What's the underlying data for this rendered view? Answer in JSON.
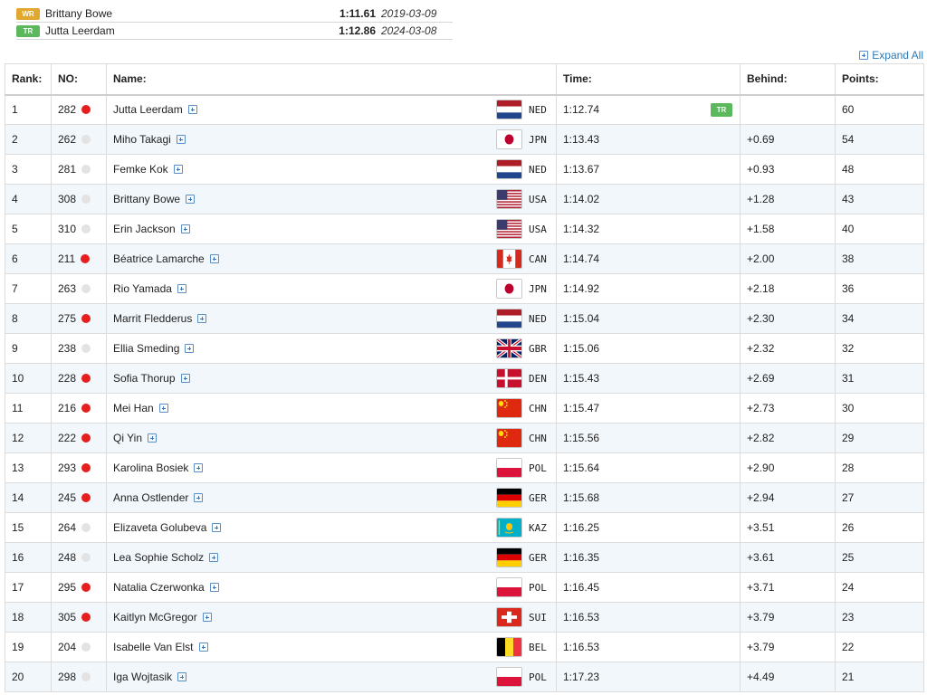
{
  "records": [
    {
      "badge": "WR",
      "badge_color": "#e0a82e",
      "name": "Brittany Bowe",
      "time": "1:11.61",
      "date": "2019-03-09"
    },
    {
      "badge": "TR",
      "badge_color": "#5cb85c",
      "name": "Jutta Leerdam",
      "time": "1:12.86",
      "date": "2024-03-08"
    }
  ],
  "expand_all_label": "Expand All",
  "table": {
    "headers": {
      "rank": "Rank:",
      "no": "NO:",
      "name": "Name:",
      "time": "Time:",
      "behind": "Behind:",
      "points": "Points:"
    },
    "tr_badge": "TR",
    "rows": [
      {
        "rank": "1",
        "no": "282",
        "dot": "red",
        "name": "Jutta Leerdam",
        "flag": "NED",
        "code": "NED",
        "time": "1:12.74",
        "badge": "TR",
        "behind": "",
        "points": "60"
      },
      {
        "rank": "2",
        "no": "262",
        "dot": "grey",
        "name": "Miho Takagi",
        "flag": "JPN",
        "code": "JPN",
        "time": "1:13.43",
        "badge": "",
        "behind": "+0.69",
        "points": "54"
      },
      {
        "rank": "3",
        "no": "281",
        "dot": "grey",
        "name": "Femke Kok",
        "flag": "NED",
        "code": "NED",
        "time": "1:13.67",
        "badge": "",
        "behind": "+0.93",
        "points": "48"
      },
      {
        "rank": "4",
        "no": "308",
        "dot": "grey",
        "name": "Brittany Bowe",
        "flag": "USA",
        "code": "USA",
        "time": "1:14.02",
        "badge": "",
        "behind": "+1.28",
        "points": "43"
      },
      {
        "rank": "5",
        "no": "310",
        "dot": "grey",
        "name": "Erin Jackson",
        "flag": "USA",
        "code": "USA",
        "time": "1:14.32",
        "badge": "",
        "behind": "+1.58",
        "points": "40"
      },
      {
        "rank": "6",
        "no": "211",
        "dot": "red",
        "name": "Béatrice Lamarche",
        "flag": "CAN",
        "code": "CAN",
        "time": "1:14.74",
        "badge": "",
        "behind": "+2.00",
        "points": "38"
      },
      {
        "rank": "7",
        "no": "263",
        "dot": "grey",
        "name": "Rio Yamada",
        "flag": "JPN",
        "code": "JPN",
        "time": "1:14.92",
        "badge": "",
        "behind": "+2.18",
        "points": "36"
      },
      {
        "rank": "8",
        "no": "275",
        "dot": "red",
        "name": "Marrit Fledderus",
        "flag": "NED",
        "code": "NED",
        "time": "1:15.04",
        "badge": "",
        "behind": "+2.30",
        "points": "34"
      },
      {
        "rank": "9",
        "no": "238",
        "dot": "grey",
        "name": "Ellia Smeding",
        "flag": "GBR",
        "code": "GBR",
        "time": "1:15.06",
        "badge": "",
        "behind": "+2.32",
        "points": "32"
      },
      {
        "rank": "10",
        "no": "228",
        "dot": "red",
        "name": "Sofia Thorup",
        "flag": "DEN",
        "code": "DEN",
        "time": "1:15.43",
        "badge": "",
        "behind": "+2.69",
        "points": "31"
      },
      {
        "rank": "11",
        "no": "216",
        "dot": "red",
        "name": "Mei Han",
        "flag": "CHN",
        "code": "CHN",
        "time": "1:15.47",
        "badge": "",
        "behind": "+2.73",
        "points": "30"
      },
      {
        "rank": "12",
        "no": "222",
        "dot": "red",
        "name": "Qi Yin",
        "flag": "CHN",
        "code": "CHN",
        "time": "1:15.56",
        "badge": "",
        "behind": "+2.82",
        "points": "29"
      },
      {
        "rank": "13",
        "no": "293",
        "dot": "red",
        "name": "Karolina Bosiek",
        "flag": "POL",
        "code": "POL",
        "time": "1:15.64",
        "badge": "",
        "behind": "+2.90",
        "points": "28"
      },
      {
        "rank": "14",
        "no": "245",
        "dot": "red",
        "name": "Anna Ostlender",
        "flag": "GER",
        "code": "GER",
        "time": "1:15.68",
        "badge": "",
        "behind": "+2.94",
        "points": "27"
      },
      {
        "rank": "15",
        "no": "264",
        "dot": "grey",
        "name": "Elizaveta Golubeva",
        "flag": "KAZ",
        "code": "KAZ",
        "time": "1:16.25",
        "badge": "",
        "behind": "+3.51",
        "points": "26"
      },
      {
        "rank": "16",
        "no": "248",
        "dot": "grey",
        "name": "Lea Sophie Scholz",
        "flag": "GER",
        "code": "GER",
        "time": "1:16.35",
        "badge": "",
        "behind": "+3.61",
        "points": "25"
      },
      {
        "rank": "17",
        "no": "295",
        "dot": "red",
        "name": "Natalia Czerwonka",
        "flag": "POL",
        "code": "POL",
        "time": "1:16.45",
        "badge": "",
        "behind": "+3.71",
        "points": "24"
      },
      {
        "rank": "18",
        "no": "305",
        "dot": "red",
        "name": "Kaitlyn McGregor",
        "flag": "SUI",
        "code": "SUI",
        "time": "1:16.53",
        "badge": "",
        "behind": "+3.79",
        "points": "23"
      },
      {
        "rank": "19",
        "no": "204",
        "dot": "grey",
        "name": "Isabelle Van Elst",
        "flag": "BEL",
        "code": "BEL",
        "time": "1:16.53",
        "badge": "",
        "behind": "+3.79",
        "points": "22"
      },
      {
        "rank": "20",
        "no": "298",
        "dot": "grey",
        "name": "Iga Wojtasik",
        "flag": "POL",
        "code": "POL",
        "time": "1:17.23",
        "badge": "",
        "behind": "+4.49",
        "points": "21"
      }
    ]
  },
  "colors": {
    "tr_badge": "#5cb85c",
    "wr_badge": "#e0a82e",
    "dot_red": "#e61e1e",
    "dot_grey": "#e3e3e3",
    "link": "#2a7ab8",
    "row_alt": "#f2f7fb"
  }
}
